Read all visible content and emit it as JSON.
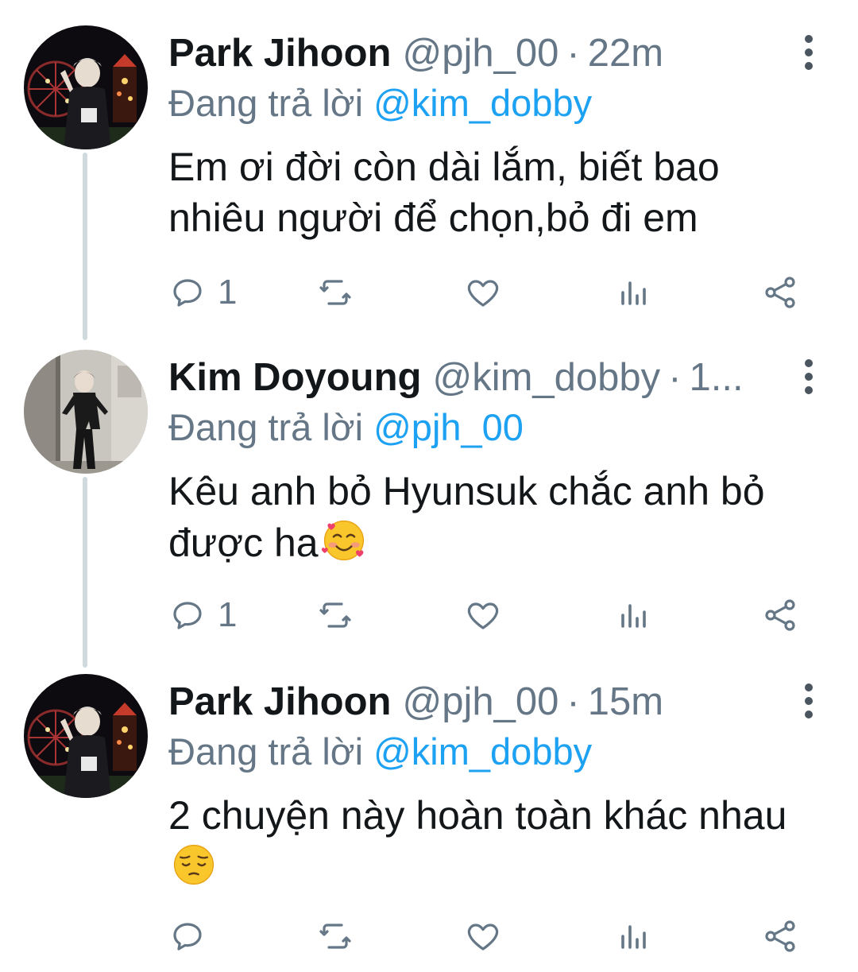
{
  "tweets": [
    {
      "name": "Park Jihoon",
      "handle": "@pjh_00",
      "separator": "·",
      "time": "22m",
      "reply_prefix": "Đang trả lời",
      "reply_to": "@kim_dobby",
      "text": "Em ơi đời còn dài lắm, biết bao nhiêu người để chọn,bỏ đi em",
      "emoji": "",
      "actions": {
        "reply_count": "1",
        "retweet_count": "",
        "like_count": ""
      }
    },
    {
      "name": "Kim Doyoung",
      "handle": "@kim_dobby",
      "separator": "·",
      "time": "1...",
      "reply_prefix": "Đang trả lời",
      "reply_to": "@pjh_00",
      "text": "Kêu anh bỏ Hyunsuk chắc anh bỏ được ha",
      "emoji": "smiling-face-with-hearts",
      "actions": {
        "reply_count": "1",
        "retweet_count": "",
        "like_count": ""
      }
    },
    {
      "name": "Park Jihoon",
      "handle": "@pjh_00",
      "separator": "·",
      "time": "15m",
      "reply_prefix": "Đang trả lời",
      "reply_to": "@kim_dobby",
      "text": "2 chuyện này hoàn toàn khác nhau",
      "emoji": "pensive-face",
      "actions": {
        "reply_count": "",
        "retweet_count": "",
        "like_count": ""
      }
    }
  ],
  "icons": [
    "reply-icon",
    "retweet-icon",
    "like-icon",
    "analytics-icon",
    "share-icon",
    "more-options-icon"
  ],
  "colors": {
    "text": "#14171a",
    "secondary": "#657786",
    "accent": "#1da1f2",
    "thread_line": "#cfd9de"
  }
}
